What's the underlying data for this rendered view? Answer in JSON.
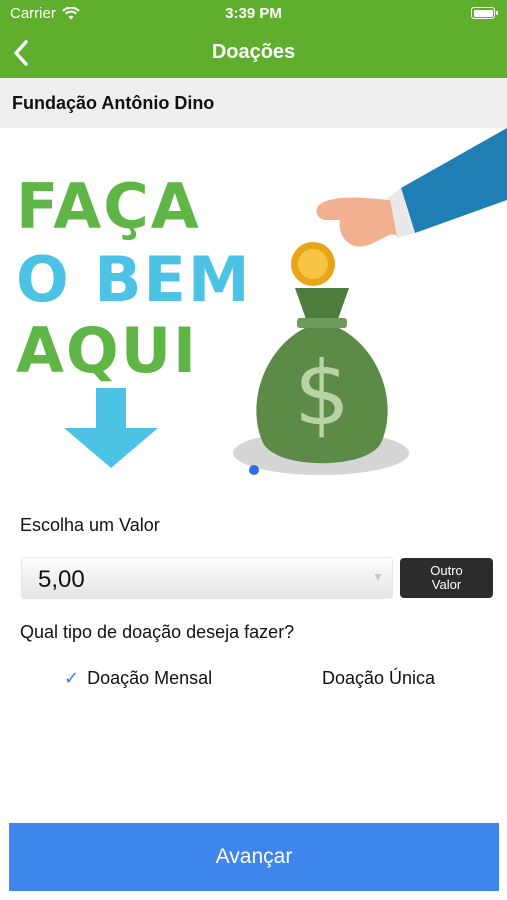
{
  "status_bar": {
    "carrier": "Carrier",
    "time": "3:39 PM"
  },
  "nav": {
    "title": "Doações"
  },
  "organization": {
    "name": "Fundação Antônio Dino"
  },
  "banner": {
    "line1": "FAÇA",
    "line2": "O BEM",
    "line3": "AQUI"
  },
  "value": {
    "label": "Escolha um Valor",
    "selected": "5,00",
    "other_button": "Outro\nValor"
  },
  "donation_type": {
    "question": "Qual tipo de doação deseja fazer?",
    "monthly_label": "Doação Mensal",
    "single_label": "Doação Única",
    "selected": "monthly"
  },
  "colors": {
    "brand_green": "#5fae2e",
    "button_blue": "#3e86ec",
    "banner_green": "#5fb545",
    "banner_blue": "#4cc3e4"
  },
  "footer": {
    "advance_label": "Avançar"
  }
}
